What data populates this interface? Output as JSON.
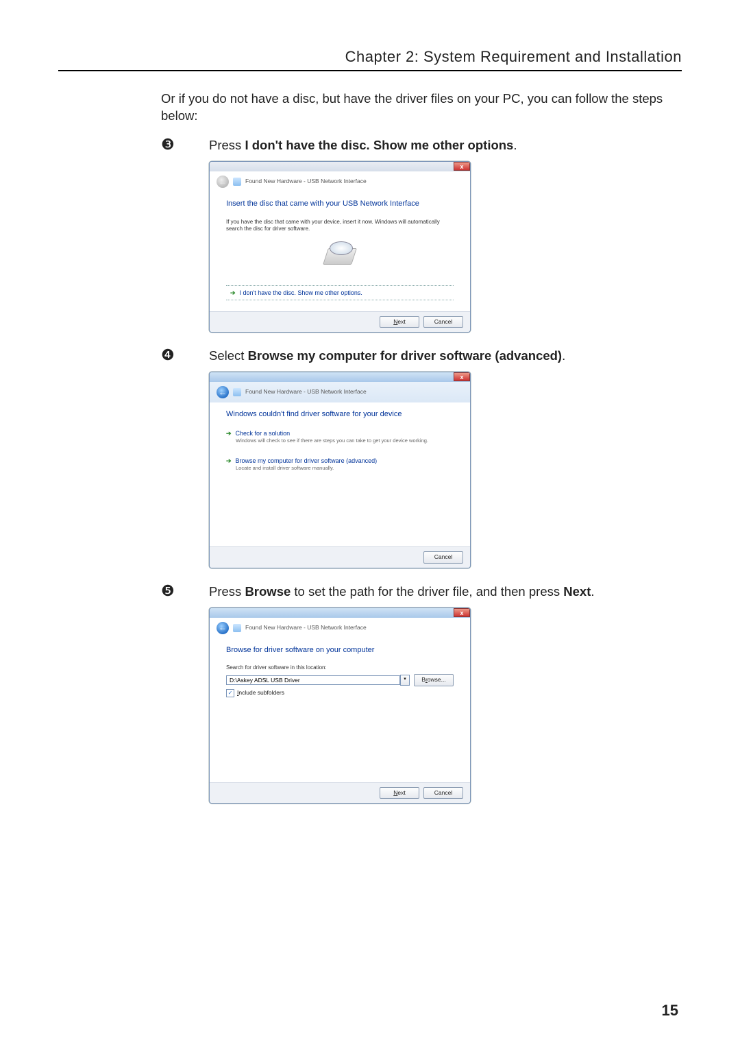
{
  "chapter_header": "Chapter 2: System Requirement and Installation",
  "intro": "Or if you do not have a disc, but have the driver files on your PC, you can follow the steps below:",
  "page_number": "15",
  "steps": {
    "s3": {
      "num": "❸",
      "prefix": "Press ",
      "bold": "I don't have the disc. Show me other options",
      "suffix": "."
    },
    "s4": {
      "num": "❹",
      "prefix": "Select ",
      "bold": "Browse my computer for driver software (advanced)",
      "suffix": "."
    },
    "s5": {
      "num": "❺",
      "prefix": "Press ",
      "bold1": "Browse",
      "mid": " to set the path for the driver file, and then press ",
      "bold2": "Next",
      "suffix": "."
    }
  },
  "win1": {
    "crumb": "Found New Hardware - USB Network Interface",
    "heading": "Insert the disc that came with your USB Network Interface",
    "sub": "If you have the disc that came with your device, insert it now. Windows will automatically search the disc for driver software.",
    "link": "I don't have the disc. Show me other options.",
    "next": "Next",
    "cancel": "Cancel",
    "close": "x"
  },
  "win2": {
    "crumb": "Found New Hardware - USB Network Interface",
    "heading": "Windows couldn't find driver software for your device",
    "opt1_title": "Check for a solution",
    "opt1_desc": "Windows will check to see if there are steps you can take to get your device working.",
    "opt2_title": "Browse my computer for driver software (advanced)",
    "opt2_desc": "Locate and install driver software manually.",
    "cancel": "Cancel",
    "close": "x"
  },
  "win3": {
    "crumb": "Found New Hardware - USB Network Interface",
    "heading": "Browse for driver software on your computer",
    "field_label": "Search for driver software in this location:",
    "path_value": "D:\\Askey ADSL USB Driver",
    "browse": "Browse...",
    "include_subfolders": "Include subfolders",
    "next": "Next",
    "cancel": "Cancel",
    "close": "x"
  }
}
